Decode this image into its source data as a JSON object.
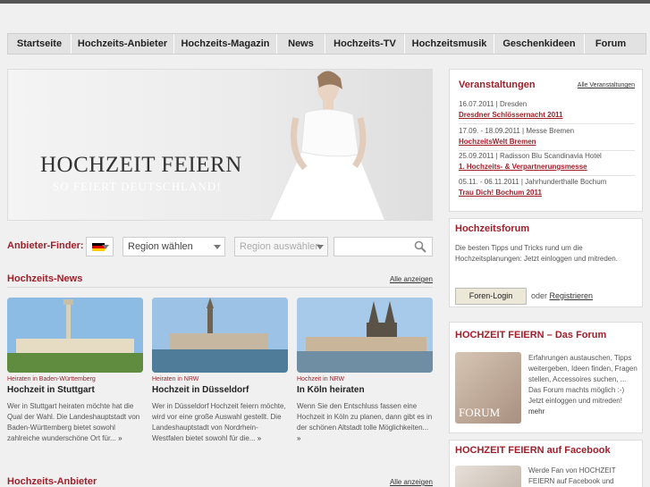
{
  "nav": [
    "Startseite",
    "Hochzeits-Anbieter",
    "Hochzeits-Magazin",
    "News",
    "Hochzeits-TV",
    "Hochzeitsmusik",
    "Geschenkideen",
    "Forum"
  ],
  "hero": {
    "title": "HOCHZEIT FEIERN",
    "subtitle": "SO FEIERT DEUTSCHLAND!"
  },
  "finder": {
    "label": "Anbieter-Finder:",
    "region1": "Region wählen",
    "region2": "Region auswählen"
  },
  "news": {
    "heading": "Hochzeits-News",
    "all": "Alle anzeigen",
    "cards": [
      {
        "region": "Heiraten in Baden-Württemberg",
        "title": "Hochzeit in Stuttgart",
        "text": "Wer in Stuttgart heiraten möchte hat die Qual der Wahl. Die Landeshauptstadt von Baden-Württemberg bietet sowohl zahlreiche wunderschöne Ort für...",
        "more": "»"
      },
      {
        "region": "Heiraten in NRW",
        "title": "Hochzeit in Düsseldorf",
        "text": "Wer in Düsseldorf Hochzeit feiern möchte, wird vor eine große Auswahl gestellt. Die Landeshauptstadt von Nordrhein-Westfalen bietet sowohl für die...",
        "more": "»"
      },
      {
        "region": "Hochzeit in NRW",
        "title": "In Köln heiraten",
        "text": "Wenn Sie den Entschluss fassen eine Hochzeit in Köln zu planen, dann gibt es in der schönen Altstadt tolle Möglichkeiten...",
        "more": "»"
      }
    ]
  },
  "anbieter": {
    "heading": "Hochzeits-Anbieter",
    "all": "Alle anzeigen"
  },
  "events": {
    "heading": "Veranstaltungen",
    "all": "Alle Veranstaltungen",
    "items": [
      {
        "meta": "16.07.2011 | Dresden",
        "name": "Dresdner Schlössernacht 2011"
      },
      {
        "meta": "17.09. - 18.09.2011 | Messe Bremen",
        "name": "HochzeitsWelt Bremen"
      },
      {
        "meta": "25.09.2011 | Radisson Blu Scandinavia Hotel",
        "name": "1. Hochzeits- & Verpartnerungsmesse"
      },
      {
        "meta": "05.11. - 06.11.2011 | Jahrhunderthalle Bochum",
        "name": "Trau Dich! Bochum 2011"
      }
    ]
  },
  "forum": {
    "heading": "Hochzeitsforum",
    "text": "Die besten Tipps und Tricks rund um die Hochzeitsplanungen: Jetzt einloggen und mitreden.",
    "login": "Foren-Login",
    "or": "oder",
    "register": "Registrieren"
  },
  "forum2": {
    "heading": "HOCHZEIT FEIERN – Das Forum",
    "imglabel": "FORUM",
    "text": "Erfahrungen austauschen, Tipps weitergeben, Ideen finden, Fragen stellen, Accessoires suchen, ... Das Forum machts möglich :-) Jetzt einloggen und mitreden!",
    "more": "mehr"
  },
  "facebook": {
    "heading": "HOCHZEIT FEIERN auf Facebook",
    "text": "Werde Fan von HOCHZEIT FEIERN auf Facebook und"
  }
}
